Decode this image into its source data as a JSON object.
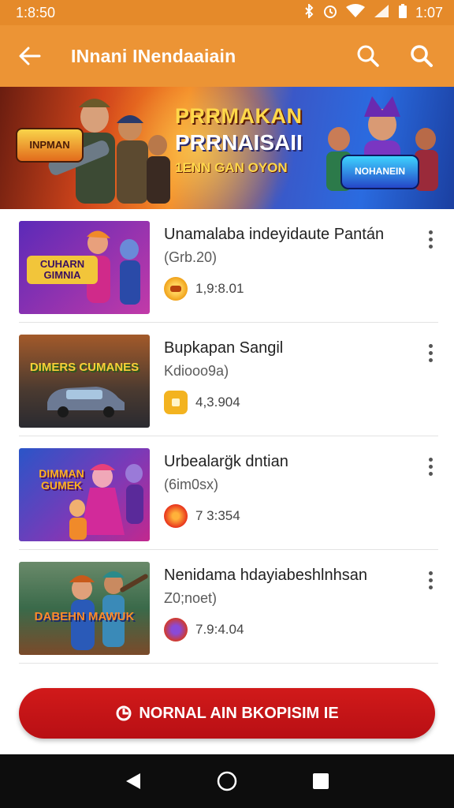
{
  "status": {
    "time": "1:8:50",
    "battery": "1:07"
  },
  "appbar": {
    "title": "INnani INendaaiain"
  },
  "banner": {
    "logo_left": "INPMAN",
    "line1": "PRRMAKAN",
    "line2": "PRRNAISAII",
    "line3": "1ENN GAN OYON",
    "logo_right": "NOHANEIN"
  },
  "items": [
    {
      "title": "Unamalaba indeyidaute Pantán",
      "subtitle": "(Grb.20)",
      "value": "1,9:8.01",
      "thumb_label": "CUHARN GIMNIA",
      "thumb_colors": [
        "#5b2ab8",
        "#c23aa8"
      ],
      "label_color": "#f2c53a",
      "coin_color": "#f0a21a"
    },
    {
      "title": "Bupkapan Sangil",
      "subtitle": "Kdiooo9a)",
      "value": "4,3.904",
      "thumb_label": "DIMERS CUMANES",
      "thumb_colors": [
        "#7a4a2a",
        "#3d6fa6"
      ],
      "label_color": "#f7d038",
      "coin_color": "#f3b320"
    },
    {
      "title": "Urbealarg̈k dntian",
      "subtitle": "(6im0sx)",
      "value": "7 3:354",
      "thumb_label": "DIMMAN GUMEK",
      "thumb_colors": [
        "#2a55c8",
        "#c2288e"
      ],
      "label_color": "#ffb21d",
      "coin_color": "#e8321c"
    },
    {
      "title": "Nenidama hdayiabeshlnhsan",
      "subtitle": "Z0;noet)",
      "value": "7.9:4.04",
      "thumb_label": "DABEHN MAWUK",
      "thumb_colors": [
        "#3a7a56",
        "#b8562a"
      ],
      "label_color": "#ff8b2a",
      "coin_color": "#d23a2a"
    }
  ],
  "cta": {
    "label": "NORNAL AIN BKOPISIM IE"
  }
}
